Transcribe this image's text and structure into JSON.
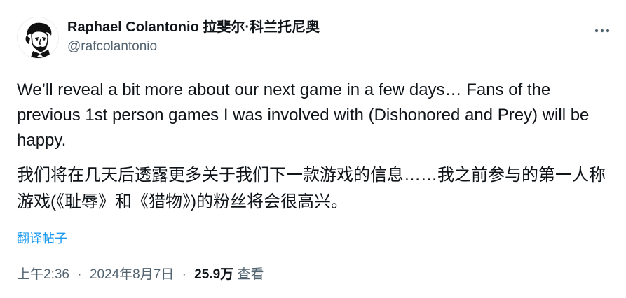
{
  "tweet": {
    "author": {
      "display_name": "Raphael Colantonio 拉斐尔·科兰托尼奥",
      "handle": "@rafcolantonio",
      "avatar_icon": "portrait-avatar-icon"
    },
    "more_icon": "more-options-icon",
    "text_en": "We’ll reveal a bit more about our next game in a few days…  Fans of the previous 1st person games I was involved with (Dishonored and Prey) will be happy.",
    "text_zh": "我们将在几天后透露更多关于我们下一款游戏的信息……我之前参与的第一人称游戏(《耻辱》和《猎物》)的粉丝将会很高兴。",
    "translate_label": "翻译帖子",
    "time": "上午2:36",
    "separator": "·",
    "date": "2024年8月7日",
    "views_count": "25.9万",
    "views_label": "查看",
    "colors": {
      "text": "#0f1419",
      "secondary": "#536471",
      "link": "#1d9bf0"
    }
  }
}
